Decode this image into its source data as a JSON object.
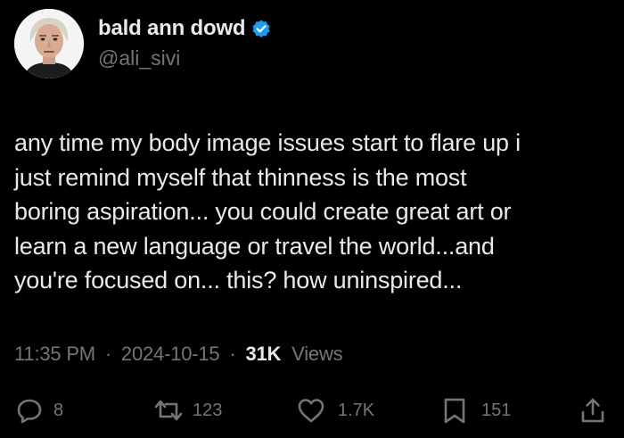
{
  "author": {
    "display_name": "bald ann dowd",
    "handle": "@ali_sivi",
    "verified": true,
    "avatar": "profile-photo"
  },
  "tweet": {
    "lines": [
      "any time my body image issues start to flare up i",
      "just remind myself that thinness is the most",
      "boring aspiration... you could create great art or",
      "learn a new language or travel the world...and",
      "you're focused on... this? how uninspired..."
    ]
  },
  "meta": {
    "time": "11:35 PM",
    "separator": "·",
    "date": "2024-10-15",
    "views_count": "31K",
    "views_label": "Views"
  },
  "actions": {
    "reply_count": "8",
    "retweet_count": "123",
    "like_count": "1.7K",
    "bookmark_count": "151"
  },
  "icons": {
    "reply": "reply-icon",
    "retweet": "retweet-icon",
    "like": "heart-icon",
    "bookmark": "bookmark-icon",
    "share": "share-icon",
    "verified": "verified-badge-icon"
  },
  "colors": {
    "background": "#000000",
    "text": "#e7e9ea",
    "secondary": "#71767b",
    "verified": "#1d9bf0"
  }
}
